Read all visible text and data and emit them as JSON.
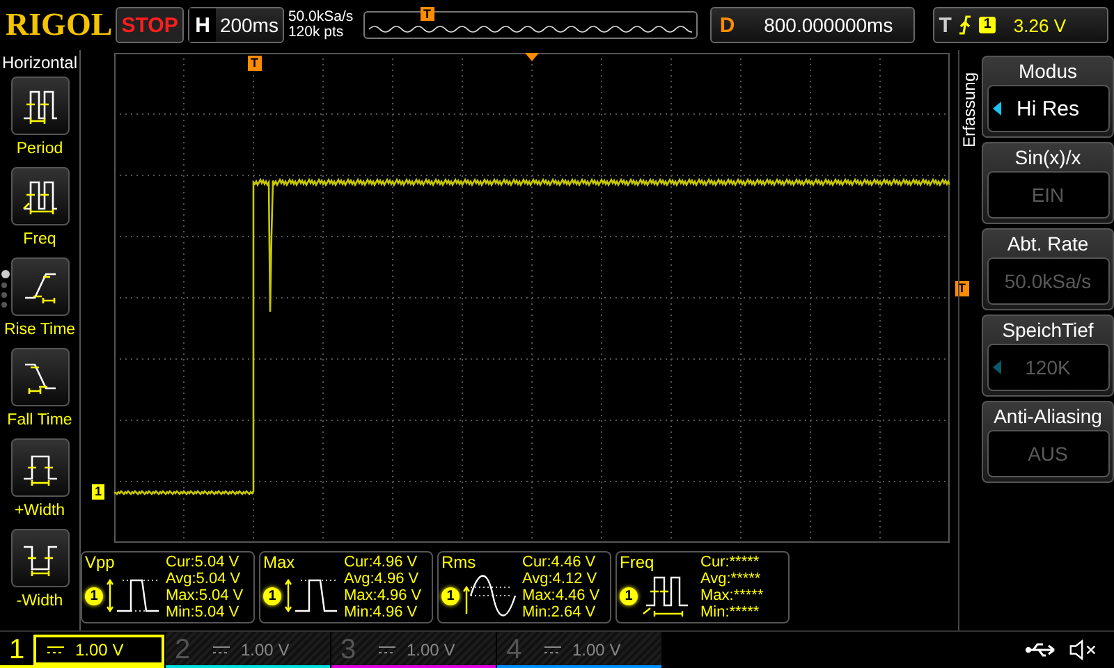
{
  "top_bar": {
    "logo": "RIGOL",
    "run_state": {
      "label": "STOP",
      "running": false
    },
    "timebase": {
      "key": "H",
      "value": "200ms"
    },
    "sample_rate": "50.0kSa/s",
    "memory_depth": "120k pts",
    "memory_marker": "T",
    "delay": {
      "key": "D",
      "value": "800.000000ms"
    },
    "trigger": {
      "key": "T",
      "rising_edge": true,
      "channel": "1",
      "level": "3.26 V"
    }
  },
  "sidebar": {
    "title": "Horizontal",
    "items": [
      {
        "label": "Period",
        "kind": "period"
      },
      {
        "label": "Freq",
        "kind": "freq"
      },
      {
        "label": "Rise Time",
        "kind": "rise"
      },
      {
        "label": "Fall Time",
        "kind": "fall"
      },
      {
        "label": "+Width",
        "kind": "pwidth"
      },
      {
        "label": "-Width",
        "kind": "nwidth"
      }
    ],
    "pages": [
      {
        "selected": true
      },
      {
        "selected": false
      },
      {
        "selected": false
      },
      {
        "selected": false
      }
    ]
  },
  "screen": {
    "trigger_position_marker": "T",
    "trigger_level_marker": "T",
    "channel_marker": "1"
  },
  "measurements": [
    {
      "name": "Vpp",
      "channel": "1",
      "kind": "vpp",
      "stats": [
        "Cur:5.04 V",
        "Avg:5.04 V",
        "Max:5.04 V",
        "Min:5.04 V"
      ]
    },
    {
      "name": "Max",
      "channel": "1",
      "kind": "max",
      "stats": [
        "Cur:4.96 V",
        "Avg:4.96 V",
        "Max:4.96 V",
        "Min:4.96 V"
      ]
    },
    {
      "name": "Rms",
      "channel": "1",
      "kind": "rms",
      "stats": [
        "Cur:4.46 V",
        "Avg:4.12 V",
        "Max:4.46 V",
        "Min:2.64 V"
      ]
    },
    {
      "name": "Freq",
      "channel": "1",
      "kind": "freq",
      "stats": [
        "Cur:*****",
        "Avg:*****",
        "Max:*****",
        "Min:*****"
      ]
    }
  ],
  "menu": {
    "title": "Erfassung",
    "items": [
      {
        "label": "Modus",
        "value": "Hi Res",
        "disabled": false,
        "has_options": true
      },
      {
        "label": "Sin(x)/x",
        "value": "EIN",
        "disabled": true,
        "has_options": false
      },
      {
        "label": "Abt. Rate",
        "value": "50.0kSa/s",
        "disabled": true,
        "has_options": false
      },
      {
        "label": "SpeichTief",
        "value": "120K",
        "disabled": true,
        "has_options": true
      },
      {
        "label": "Anti-Aliasing",
        "value": "AUS",
        "disabled": true,
        "has_options": false
      }
    ]
  },
  "channels": [
    {
      "number": "1",
      "scale": "1.00 V",
      "selected": true,
      "color": "#ffff00"
    },
    {
      "number": "2",
      "scale": "1.00 V",
      "selected": false,
      "color": "#00e0e0"
    },
    {
      "number": "3",
      "scale": "1.00 V",
      "selected": false,
      "color": "#e000e0"
    },
    {
      "number": "4",
      "scale": "1.00 V",
      "selected": false,
      "color": "#0090ff"
    }
  ]
}
